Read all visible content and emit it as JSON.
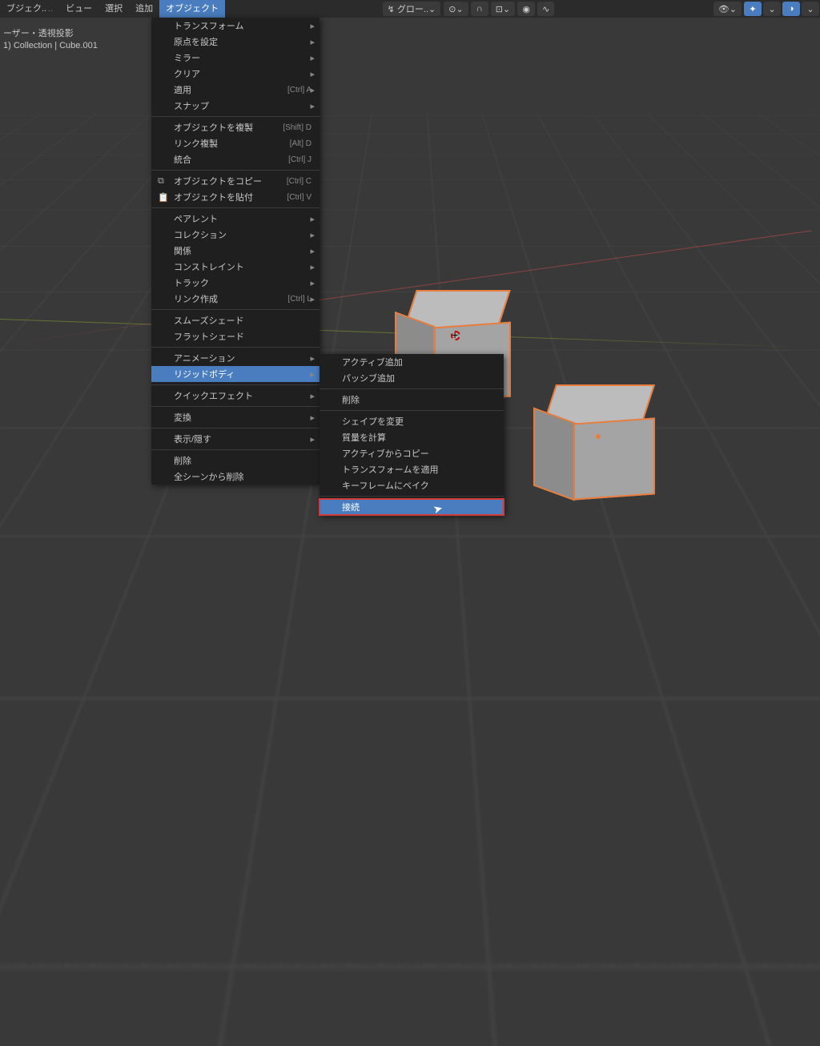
{
  "topbar": {
    "mode_label": "ブジェク..",
    "menus": [
      "ビュー",
      "選択",
      "追加",
      "オブジェクト"
    ],
    "orient_label": "グロー..",
    "snap_label": "⌄"
  },
  "overlay": {
    "line1": "ーザー・透視投影",
    "line2": "1) Collection | Cube.001"
  },
  "object_menu": [
    {
      "label": "トランスフォーム",
      "sub": true
    },
    {
      "label": "原点を設定",
      "sub": true
    },
    {
      "label": "ミラー",
      "sub": true
    },
    {
      "label": "クリア",
      "sub": true
    },
    {
      "label": "適用",
      "shortcut": "[Ctrl] A",
      "sub": true
    },
    {
      "label": "スナップ",
      "sub": true
    },
    {
      "sep": true
    },
    {
      "label": "オブジェクトを複製",
      "shortcut": "[Shift] D"
    },
    {
      "label": "リンク複製",
      "shortcut": "[Alt] D"
    },
    {
      "label": "統合",
      "shortcut": "[Ctrl] J"
    },
    {
      "sep": true
    },
    {
      "label": "オブジェクトをコピー",
      "shortcut": "[Ctrl] C",
      "icon": "⧉"
    },
    {
      "label": "オブジェクトを貼付",
      "shortcut": "[Ctrl] V",
      "icon": "📋"
    },
    {
      "sep": true
    },
    {
      "label": "ペアレント",
      "sub": true
    },
    {
      "label": "コレクション",
      "sub": true
    },
    {
      "label": "関係",
      "sub": true
    },
    {
      "label": "コンストレイント",
      "sub": true
    },
    {
      "label": "トラック",
      "sub": true
    },
    {
      "label": "リンク作成",
      "shortcut": "[Ctrl] L",
      "sub": true
    },
    {
      "sep": true
    },
    {
      "label": "スムーズシェード"
    },
    {
      "label": "フラットシェード"
    },
    {
      "sep": true
    },
    {
      "label": "アニメーション",
      "sub": true
    },
    {
      "label": "リジッドボディ",
      "sub": true,
      "hl": true
    },
    {
      "sep": true
    },
    {
      "label": "クイックエフェクト",
      "sub": true
    },
    {
      "sep": true
    },
    {
      "label": "変換",
      "sub": true
    },
    {
      "sep": true
    },
    {
      "label": "表示/隠す",
      "sub": true
    },
    {
      "sep": true
    },
    {
      "label": "削除"
    },
    {
      "label": "全シーンから削除"
    }
  ],
  "rigidbody_menu": [
    {
      "label": "アクティブ追加"
    },
    {
      "label": "パッシブ追加"
    },
    {
      "sep": true
    },
    {
      "label": "削除"
    },
    {
      "sep": true
    },
    {
      "label": "シェイプを変更"
    },
    {
      "label": "質量を計算"
    },
    {
      "label": "アクティブからコピー"
    },
    {
      "label": "トランスフォームを適用"
    },
    {
      "label": "キーフレームにベイク"
    },
    {
      "sep": true
    },
    {
      "label": "接続",
      "pick": true
    }
  ]
}
